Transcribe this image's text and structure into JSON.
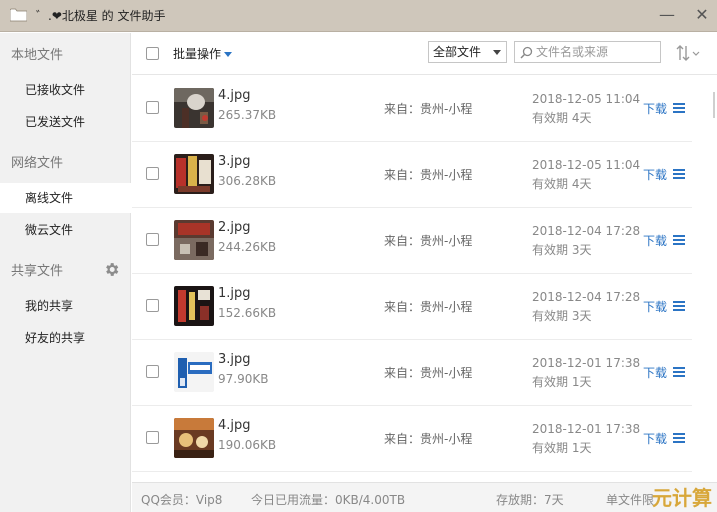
{
  "window": {
    "title": "゛.❤北极星 的 文件助手",
    "minimize_label": "—",
    "close_label": "✕"
  },
  "sidebar": {
    "local_section": "本地文件",
    "received": "已接收文件",
    "sent": "已发送文件",
    "network_section": "网络文件",
    "offline": "离线文件",
    "weiyun": "微云文件",
    "share_section": "共享文件",
    "my_share": "我的共享",
    "friend_share": "好友的共享"
  },
  "toolbar": {
    "batch_label": "批量操作",
    "filter_value": "全部文件",
    "search_placeholder": "文件名或来源"
  },
  "files": [
    {
      "name": "4.jpg",
      "size": "265.37KB",
      "from": "来自：贵州-小程",
      "date": "2018-12-05 11:04",
      "expire": "有效期 4天",
      "download": "下载"
    },
    {
      "name": "3.jpg",
      "size": "306.28KB",
      "from": "来自：贵州-小程",
      "date": "2018-12-05 11:04",
      "expire": "有效期 4天",
      "download": "下载"
    },
    {
      "name": "2.jpg",
      "size": "244.26KB",
      "from": "来自：贵州-小程",
      "date": "2018-12-04 17:28",
      "expire": "有效期 3天",
      "download": "下载"
    },
    {
      "name": "1.jpg",
      "size": "152.66KB",
      "from": "来自：贵州-小程",
      "date": "2018-12-04 17:28",
      "expire": "有效期 3天",
      "download": "下载"
    },
    {
      "name": "3.jpg",
      "size": "97.90KB",
      "from": "来自：贵州-小程",
      "date": "2018-12-01 17:38",
      "expire": "有效期 1天",
      "download": "下载"
    },
    {
      "name": "4.jpg",
      "size": "190.06KB",
      "from": "来自：贵州-小程",
      "date": "2018-12-01 17:38",
      "expire": "有效期 1天",
      "download": "下载"
    }
  ],
  "status": {
    "vip": "QQ会员：Vip8",
    "traffic": "今日已用流量：0KB/4.00TB",
    "storage": "存放期：7天",
    "single": "单文件限"
  },
  "watermark": "元计算",
  "colors": {
    "accent": "#2b74c4",
    "titlebar": "#cfc7bb",
    "sidebar": "#f1f1f1"
  }
}
